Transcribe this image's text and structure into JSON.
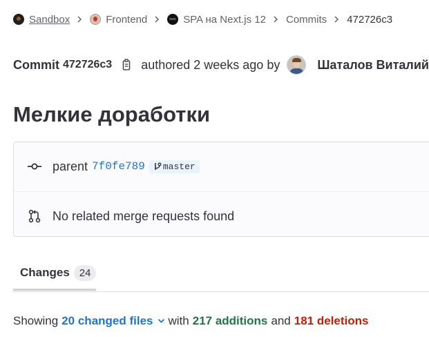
{
  "breadcrumb": {
    "items": [
      {
        "label": "Sandbox",
        "avatar": "sandbox-avatar"
      },
      {
        "label": "Frontend",
        "avatar": "frontend-avatar"
      },
      {
        "label": "SPA на Next.js 12",
        "avatar": "spa-avatar"
      },
      {
        "label": "Commits"
      },
      {
        "label": "472726c3"
      }
    ]
  },
  "commit": {
    "label": "Commit",
    "sha": "472726c3",
    "authored": "authored 2 weeks ago by",
    "author": "Шаталов Виталий",
    "title": "Мелкие доработки"
  },
  "info": {
    "parent_label": "parent",
    "parent_sha": "7f0fe789",
    "branch": "master",
    "merge_requests": "No related merge requests found"
  },
  "tabs": [
    {
      "label": "Changes",
      "count": "24"
    }
  ],
  "summary": {
    "showing": "Showing",
    "changed_files": "20 changed files",
    "with": "with",
    "additions": "217 additions",
    "and": "and",
    "deletions": "181 deletions"
  },
  "colors": {
    "link": "#1f75cb",
    "additions": "#217645",
    "deletions": "#c91c00",
    "text": "#333238"
  }
}
